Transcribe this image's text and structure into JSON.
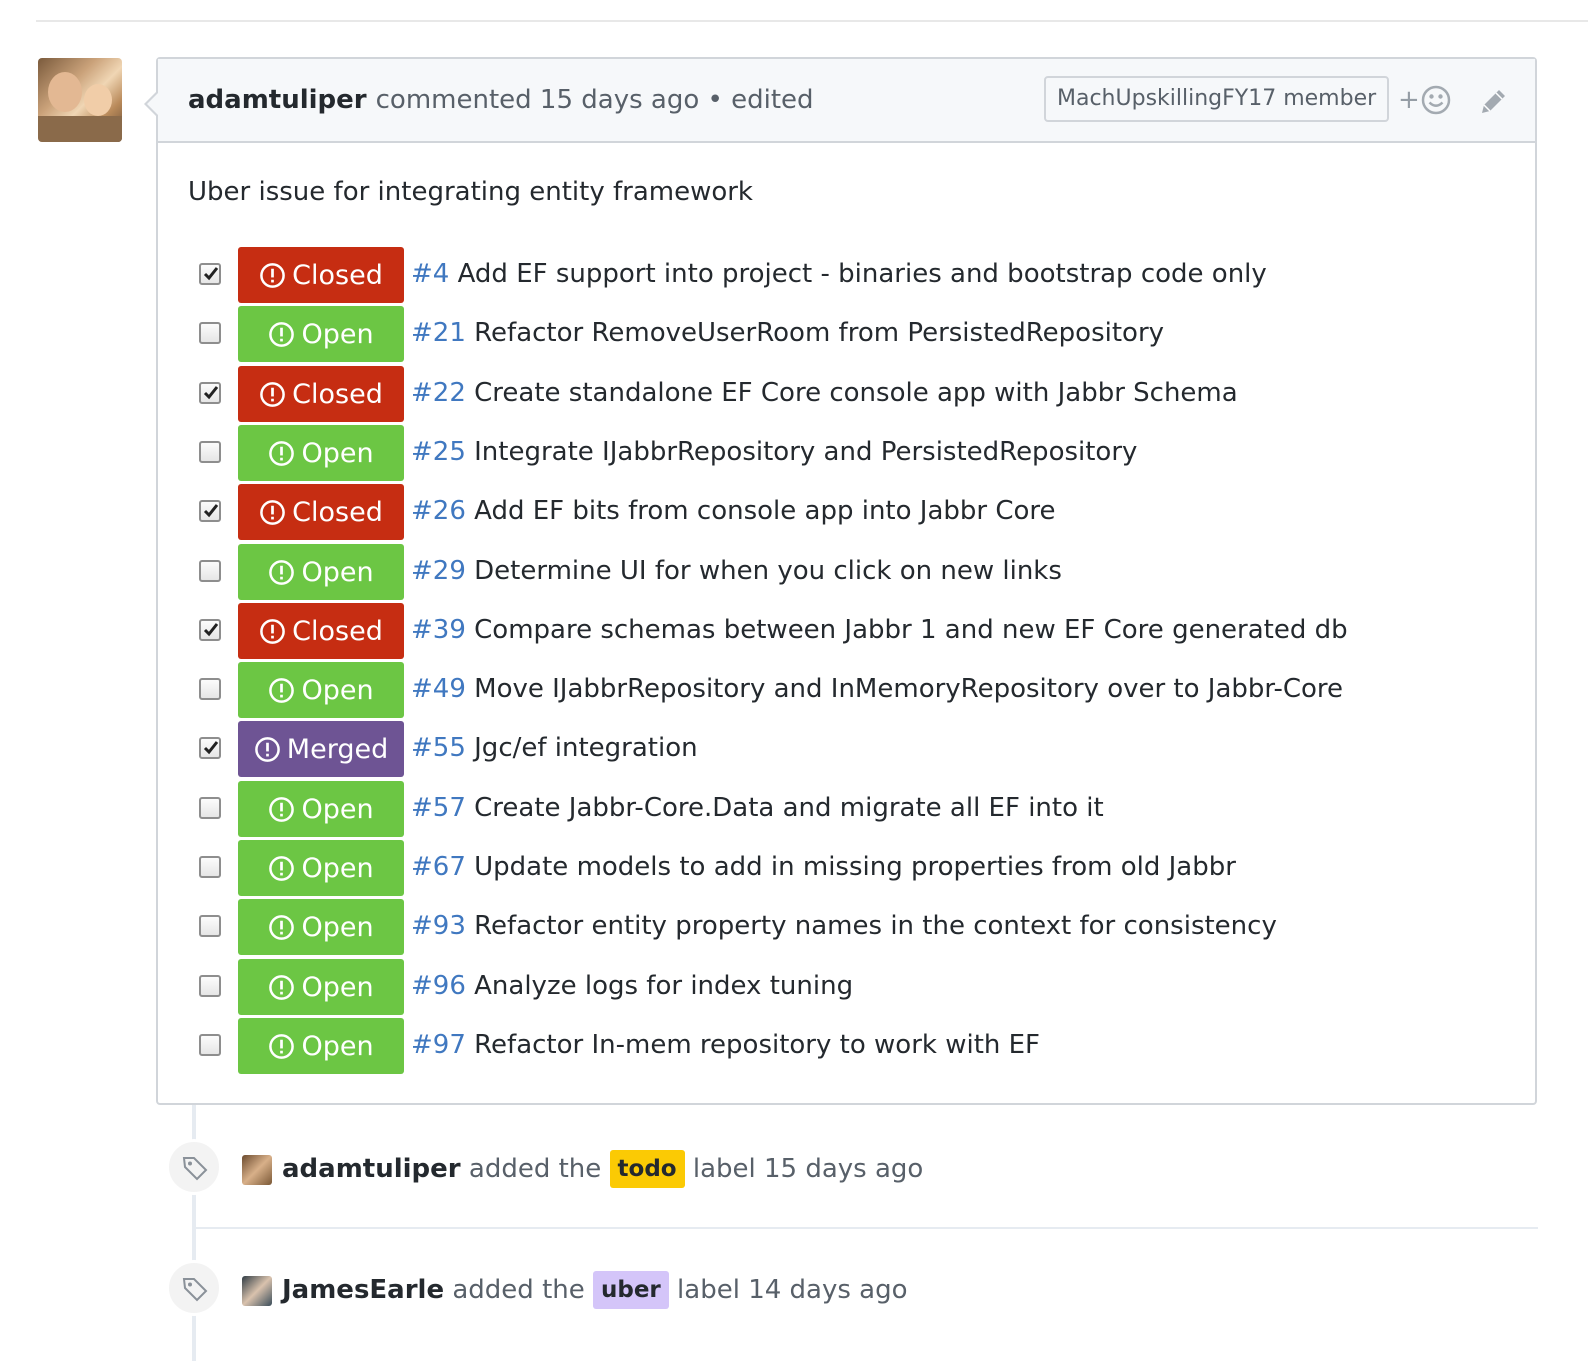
{
  "comment": {
    "author": "adamtuliper",
    "meta": "commented 15 days ago • edited",
    "role": "MachUpskillingFY17 member",
    "reaction_plus": "+",
    "body": "Uber issue for integrating entity framework"
  },
  "colors": {
    "closed": "#c62d12",
    "open": "#6cc644",
    "merged": "#6e5494",
    "link": "#4078c0",
    "label_todo": "#fbca04",
    "label_uber": "#d4c5f9"
  },
  "tasks": [
    {
      "checked": true,
      "state": "closed",
      "state_label": "Closed",
      "number": "#4",
      "title": "Add EF support into project - binaries and bootstrap code only"
    },
    {
      "checked": false,
      "state": "open",
      "state_label": "Open",
      "number": "#21",
      "title": "Refactor RemoveUserRoom from PersistedRepository"
    },
    {
      "checked": true,
      "state": "closed",
      "state_label": "Closed",
      "number": "#22",
      "title": "Create standalone EF Core console app with Jabbr Schema"
    },
    {
      "checked": false,
      "state": "open",
      "state_label": "Open",
      "number": "#25",
      "title": "Integrate IJabbrRepository and PersistedRepository"
    },
    {
      "checked": true,
      "state": "closed",
      "state_label": "Closed",
      "number": "#26",
      "title": "Add EF bits from console app into Jabbr Core"
    },
    {
      "checked": false,
      "state": "open",
      "state_label": "Open",
      "number": "#29",
      "title": "Determine UI for when you click on new links"
    },
    {
      "checked": true,
      "state": "closed",
      "state_label": "Closed",
      "number": "#39",
      "title": "Compare schemas between Jabbr 1 and new EF Core generated db"
    },
    {
      "checked": false,
      "state": "open",
      "state_label": "Open",
      "number": "#49",
      "title": "Move IJabbrRepository and InMemoryRepository over to Jabbr-Core"
    },
    {
      "checked": true,
      "state": "merged",
      "state_label": "Merged",
      "number": "#55",
      "title": "Jgc/ef integration"
    },
    {
      "checked": false,
      "state": "open",
      "state_label": "Open",
      "number": "#57",
      "title": "Create Jabbr-Core.Data and migrate all EF into it"
    },
    {
      "checked": false,
      "state": "open",
      "state_label": "Open",
      "number": "#67",
      "title": "Update models to add in missing properties from old Jabbr"
    },
    {
      "checked": false,
      "state": "open",
      "state_label": "Open",
      "number": "#93",
      "title": "Refactor entity property names in the context for consistency"
    },
    {
      "checked": false,
      "state": "open",
      "state_label": "Open",
      "number": "#96",
      "title": "Analyze logs for index tuning"
    },
    {
      "checked": false,
      "state": "open",
      "state_label": "Open",
      "number": "#97",
      "title": "Refactor In-mem repository to work with EF"
    }
  ],
  "events": [
    {
      "author": "adamtuliper",
      "pre": "added the",
      "label": "todo",
      "post": "label 15 days ago"
    },
    {
      "author": "JamesEarle",
      "pre": "added the",
      "label": "uber",
      "post": "label 14 days ago"
    }
  ]
}
